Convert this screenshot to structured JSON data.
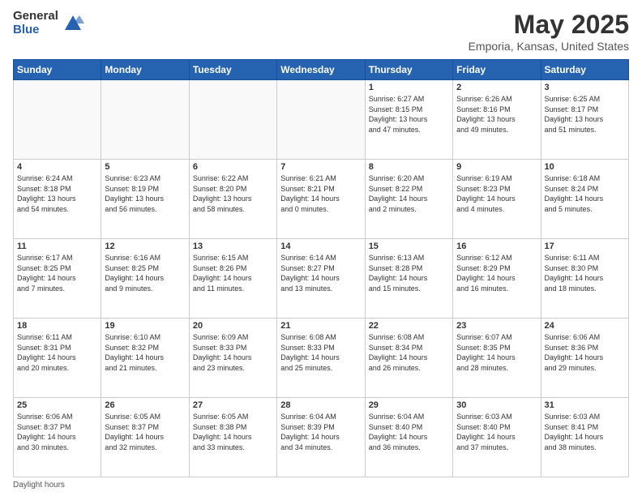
{
  "logo": {
    "general": "General",
    "blue": "Blue"
  },
  "title": "May 2025",
  "subtitle": "Emporia, Kansas, United States",
  "days_header": [
    "Sunday",
    "Monday",
    "Tuesday",
    "Wednesday",
    "Thursday",
    "Friday",
    "Saturday"
  ],
  "footer": "Daylight hours",
  "weeks": [
    [
      {
        "day": "",
        "info": ""
      },
      {
        "day": "",
        "info": ""
      },
      {
        "day": "",
        "info": ""
      },
      {
        "day": "",
        "info": ""
      },
      {
        "day": "1",
        "info": "Sunrise: 6:27 AM\nSunset: 8:15 PM\nDaylight: 13 hours\nand 47 minutes."
      },
      {
        "day": "2",
        "info": "Sunrise: 6:26 AM\nSunset: 8:16 PM\nDaylight: 13 hours\nand 49 minutes."
      },
      {
        "day": "3",
        "info": "Sunrise: 6:25 AM\nSunset: 8:17 PM\nDaylight: 13 hours\nand 51 minutes."
      }
    ],
    [
      {
        "day": "4",
        "info": "Sunrise: 6:24 AM\nSunset: 8:18 PM\nDaylight: 13 hours\nand 54 minutes."
      },
      {
        "day": "5",
        "info": "Sunrise: 6:23 AM\nSunset: 8:19 PM\nDaylight: 13 hours\nand 56 minutes."
      },
      {
        "day": "6",
        "info": "Sunrise: 6:22 AM\nSunset: 8:20 PM\nDaylight: 13 hours\nand 58 minutes."
      },
      {
        "day": "7",
        "info": "Sunrise: 6:21 AM\nSunset: 8:21 PM\nDaylight: 14 hours\nand 0 minutes."
      },
      {
        "day": "8",
        "info": "Sunrise: 6:20 AM\nSunset: 8:22 PM\nDaylight: 14 hours\nand 2 minutes."
      },
      {
        "day": "9",
        "info": "Sunrise: 6:19 AM\nSunset: 8:23 PM\nDaylight: 14 hours\nand 4 minutes."
      },
      {
        "day": "10",
        "info": "Sunrise: 6:18 AM\nSunset: 8:24 PM\nDaylight: 14 hours\nand 5 minutes."
      }
    ],
    [
      {
        "day": "11",
        "info": "Sunrise: 6:17 AM\nSunset: 8:25 PM\nDaylight: 14 hours\nand 7 minutes."
      },
      {
        "day": "12",
        "info": "Sunrise: 6:16 AM\nSunset: 8:25 PM\nDaylight: 14 hours\nand 9 minutes."
      },
      {
        "day": "13",
        "info": "Sunrise: 6:15 AM\nSunset: 8:26 PM\nDaylight: 14 hours\nand 11 minutes."
      },
      {
        "day": "14",
        "info": "Sunrise: 6:14 AM\nSunset: 8:27 PM\nDaylight: 14 hours\nand 13 minutes."
      },
      {
        "day": "15",
        "info": "Sunrise: 6:13 AM\nSunset: 8:28 PM\nDaylight: 14 hours\nand 15 minutes."
      },
      {
        "day": "16",
        "info": "Sunrise: 6:12 AM\nSunset: 8:29 PM\nDaylight: 14 hours\nand 16 minutes."
      },
      {
        "day": "17",
        "info": "Sunrise: 6:11 AM\nSunset: 8:30 PM\nDaylight: 14 hours\nand 18 minutes."
      }
    ],
    [
      {
        "day": "18",
        "info": "Sunrise: 6:11 AM\nSunset: 8:31 PM\nDaylight: 14 hours\nand 20 minutes."
      },
      {
        "day": "19",
        "info": "Sunrise: 6:10 AM\nSunset: 8:32 PM\nDaylight: 14 hours\nand 21 minutes."
      },
      {
        "day": "20",
        "info": "Sunrise: 6:09 AM\nSunset: 8:33 PM\nDaylight: 14 hours\nand 23 minutes."
      },
      {
        "day": "21",
        "info": "Sunrise: 6:08 AM\nSunset: 8:33 PM\nDaylight: 14 hours\nand 25 minutes."
      },
      {
        "day": "22",
        "info": "Sunrise: 6:08 AM\nSunset: 8:34 PM\nDaylight: 14 hours\nand 26 minutes."
      },
      {
        "day": "23",
        "info": "Sunrise: 6:07 AM\nSunset: 8:35 PM\nDaylight: 14 hours\nand 28 minutes."
      },
      {
        "day": "24",
        "info": "Sunrise: 6:06 AM\nSunset: 8:36 PM\nDaylight: 14 hours\nand 29 minutes."
      }
    ],
    [
      {
        "day": "25",
        "info": "Sunrise: 6:06 AM\nSunset: 8:37 PM\nDaylight: 14 hours\nand 30 minutes."
      },
      {
        "day": "26",
        "info": "Sunrise: 6:05 AM\nSunset: 8:37 PM\nDaylight: 14 hours\nand 32 minutes."
      },
      {
        "day": "27",
        "info": "Sunrise: 6:05 AM\nSunset: 8:38 PM\nDaylight: 14 hours\nand 33 minutes."
      },
      {
        "day": "28",
        "info": "Sunrise: 6:04 AM\nSunset: 8:39 PM\nDaylight: 14 hours\nand 34 minutes."
      },
      {
        "day": "29",
        "info": "Sunrise: 6:04 AM\nSunset: 8:40 PM\nDaylight: 14 hours\nand 36 minutes."
      },
      {
        "day": "30",
        "info": "Sunrise: 6:03 AM\nSunset: 8:40 PM\nDaylight: 14 hours\nand 37 minutes."
      },
      {
        "day": "31",
        "info": "Sunrise: 6:03 AM\nSunset: 8:41 PM\nDaylight: 14 hours\nand 38 minutes."
      }
    ]
  ]
}
